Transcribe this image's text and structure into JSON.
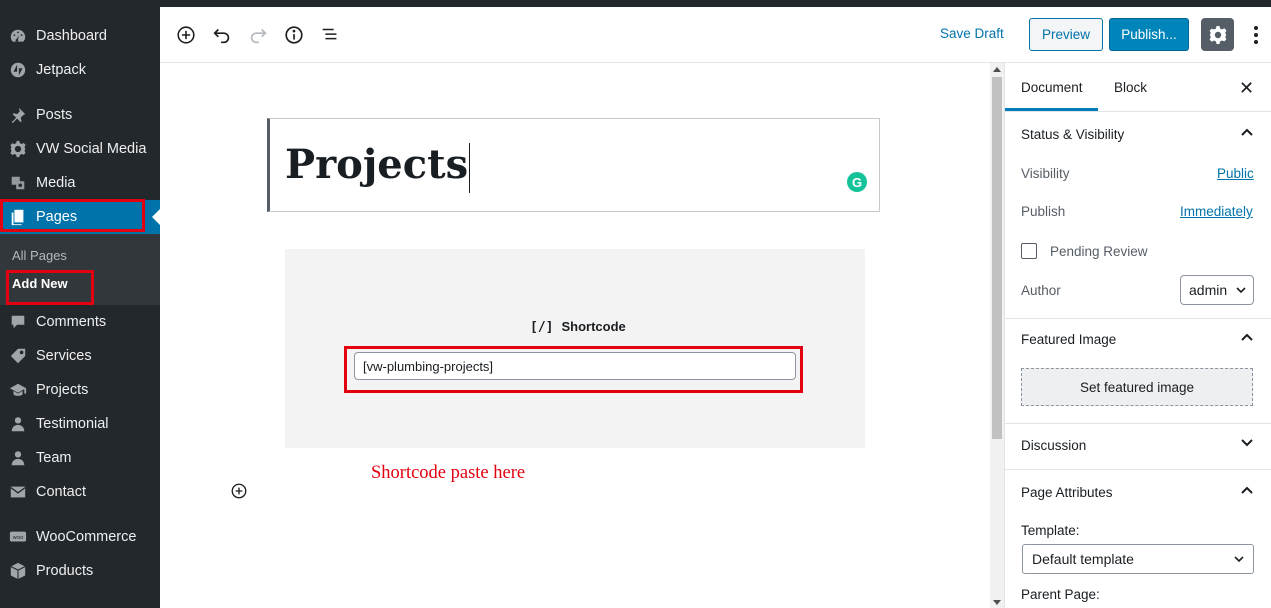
{
  "sidebar": {
    "items": [
      {
        "label": "Dashboard",
        "icon": "dashboard-icon"
      },
      {
        "label": "Jetpack",
        "icon": "jetpack-icon"
      },
      {
        "label": "Posts",
        "icon": "pin-icon"
      },
      {
        "label": "VW Social Media",
        "icon": "gear-icon"
      },
      {
        "label": "Media",
        "icon": "media-icon"
      },
      {
        "label": "Pages",
        "icon": "pages-icon"
      },
      {
        "label": "Comments",
        "icon": "comment-icon"
      },
      {
        "label": "Services",
        "icon": "tag-icon"
      },
      {
        "label": "Projects",
        "icon": "graduation-icon"
      },
      {
        "label": "Testimonial",
        "icon": "person-icon"
      },
      {
        "label": "Team",
        "icon": "person-icon"
      },
      {
        "label": "Contact",
        "icon": "mail-icon"
      },
      {
        "label": "WooCommerce",
        "icon": "woo-icon"
      },
      {
        "label": "Products",
        "icon": "box-icon"
      }
    ],
    "submenu": {
      "all_pages": "All Pages",
      "add_new": "Add New"
    }
  },
  "toolbar": {
    "save_draft": "Save Draft",
    "preview": "Preview",
    "publish": "Publish..."
  },
  "editor": {
    "title": "Projects",
    "grammarly": "G",
    "shortcode_bracket": "[/]",
    "shortcode_label": "Shortcode",
    "shortcode_value": "[vw-plumbing-projects]",
    "annotation": "Shortcode paste here"
  },
  "panel": {
    "tab_document": "Document",
    "tab_block": "Block",
    "close": "✕",
    "status_visibility": "Status & Visibility",
    "visibility_label": "Visibility",
    "visibility_value": "Public",
    "publish_label": "Publish",
    "publish_value": "Immediately",
    "pending_review": "Pending Review",
    "author_label": "Author",
    "author_value": "admin",
    "featured_image": "Featured Image",
    "set_featured": "Set featured image",
    "discussion": "Discussion",
    "page_attributes": "Page Attributes",
    "template_label": "Template:",
    "template_value": "Default template",
    "parent_page": "Parent Page:"
  },
  "colors": {
    "sidebar": "#23282d",
    "active": "#0073aa",
    "highlight": "#e3000f",
    "accent": "#0085ba"
  }
}
